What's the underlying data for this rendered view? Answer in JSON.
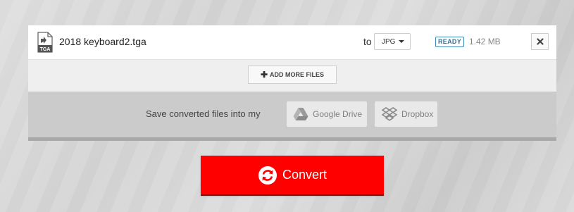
{
  "file": {
    "name": "2018 keyboard2.tga",
    "icon_label": "TGA",
    "to_label": "to",
    "target_format": "JPG",
    "status": "READY",
    "size": "1.42 MB"
  },
  "add_more": {
    "label": "ADD MORE FILES"
  },
  "save": {
    "label": "Save converted files into my",
    "google_drive": "Google Drive",
    "dropbox": "Dropbox"
  },
  "convert": {
    "label": "Convert"
  },
  "colors": {
    "convert": "#ff0000",
    "status_badge": "#3a8ab5"
  },
  "icons": [
    "file-tga-icon",
    "chevron-down-icon",
    "close-icon",
    "plus-icon",
    "google-drive-icon",
    "dropbox-icon",
    "convert-icon"
  ]
}
